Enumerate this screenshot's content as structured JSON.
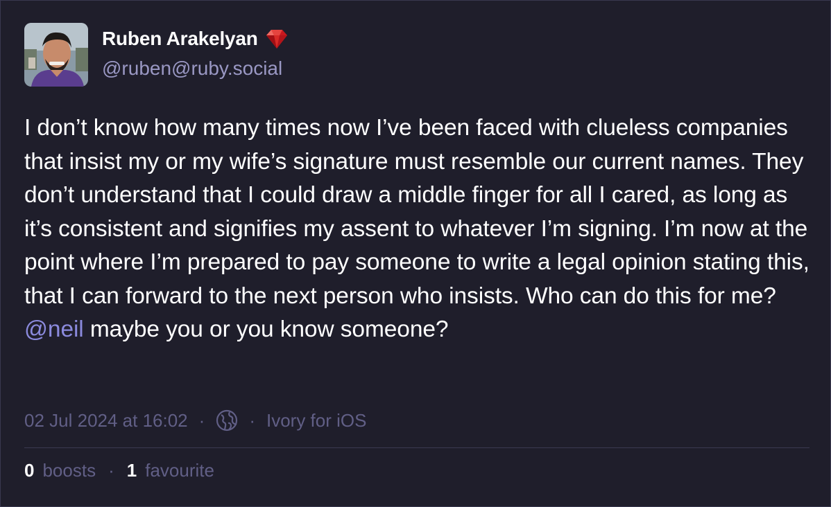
{
  "author": {
    "display_name": "Ruben Arakelyan",
    "handle": "@ruben@ruby.social",
    "name_emoji": "ruby-gem-icon"
  },
  "post": {
    "text_before_mention": "I don’t know how many times now I’ve been faced with clueless companies that insist my or my wife’s signature must resemble our current names. They don’t understand that I could draw a middle finger for all I cared, as long as it’s consistent and signifies my assent to whatever I’m signing. I’m now at the point where I’m prepared to pay someone to write a legal opinion stating this, that I can forward to the next person who insists. Who can do this for me? ",
    "mention": "@neil",
    "text_after_mention": " maybe you or you know someone?"
  },
  "meta": {
    "timestamp": "02 Jul 2024 at 16:02",
    "separator": "·",
    "visibility_icon": "globe-icon",
    "client": "Ivory for iOS"
  },
  "stats": {
    "boosts_count": "0",
    "boosts_label": "boosts",
    "separator": "·",
    "favourites_count": "1",
    "favourites_label": "favourite"
  },
  "colors": {
    "background": "#1f1e2b",
    "text": "#ffffff",
    "muted": "#615f86",
    "handle": "#9a98c4",
    "mention": "#8b8add",
    "ruby": "#c8181e"
  }
}
